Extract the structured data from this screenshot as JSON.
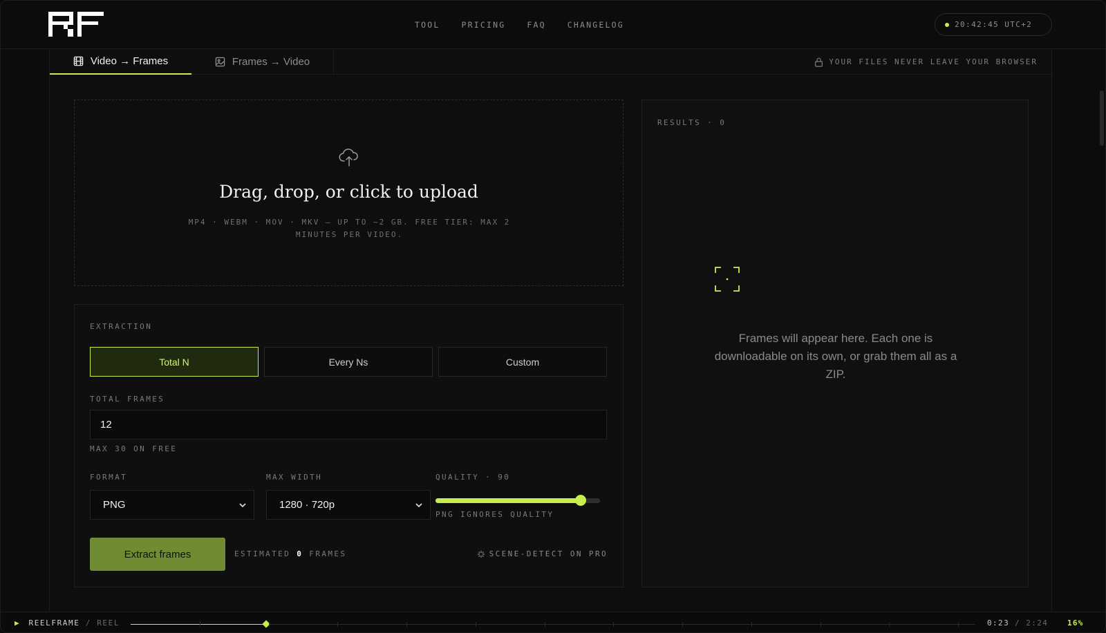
{
  "header": {
    "logo_text": "RF",
    "nav": [
      "TOOL",
      "PRICING",
      "FAQ",
      "CHANGELOG"
    ],
    "clock": "20:42:45 UTC+2"
  },
  "tabs": {
    "active": "Video → Frames",
    "inactive": "Frames → Video",
    "privacy": "YOUR FILES NEVER LEAVE YOUR BROWSER"
  },
  "upload": {
    "title": "Drag, drop, or click to upload",
    "subtitle": "MP4 · WEBM · MOV · MKV — UP TO ~2 GB. FREE TIER: MAX 2 MINUTES PER VIDEO."
  },
  "extraction": {
    "label": "EXTRACTION",
    "modes": [
      "Total N",
      "Every Ns",
      "Custom"
    ],
    "active_mode": 0,
    "total_frames_label": "TOTAL FRAMES",
    "total_frames_value": "12",
    "total_frames_hint": "MAX 30 ON FREE",
    "format_label": "FORMAT",
    "format_value": "PNG",
    "max_width_label": "MAX WIDTH",
    "max_width_value": "1280 · 720p",
    "quality_label": "QUALITY · 90",
    "quality_value": 90,
    "quality_hint": "PNG IGNORES QUALITY",
    "button_label": "Extract frames",
    "estimated_prefix": "ESTIMATED",
    "estimated_count": "0",
    "estimated_suffix": "FRAMES",
    "scene_detect": "SCENE-DETECT ON PRO"
  },
  "results": {
    "label": "RESULTS · 0",
    "empty_message": "Frames will appear here. Each one is downloadable on its own, or grab them all as a ZIP."
  },
  "bottom": {
    "brand": "REELFRAME",
    "separator": "/",
    "reel": "REEL",
    "current_time": "0:23",
    "time_separator": "/",
    "total_time": "2:24",
    "percent": "16%",
    "progress_fraction": 0.16
  },
  "colors": {
    "accent": "#c6ef4d",
    "button": "#6f8c32"
  }
}
